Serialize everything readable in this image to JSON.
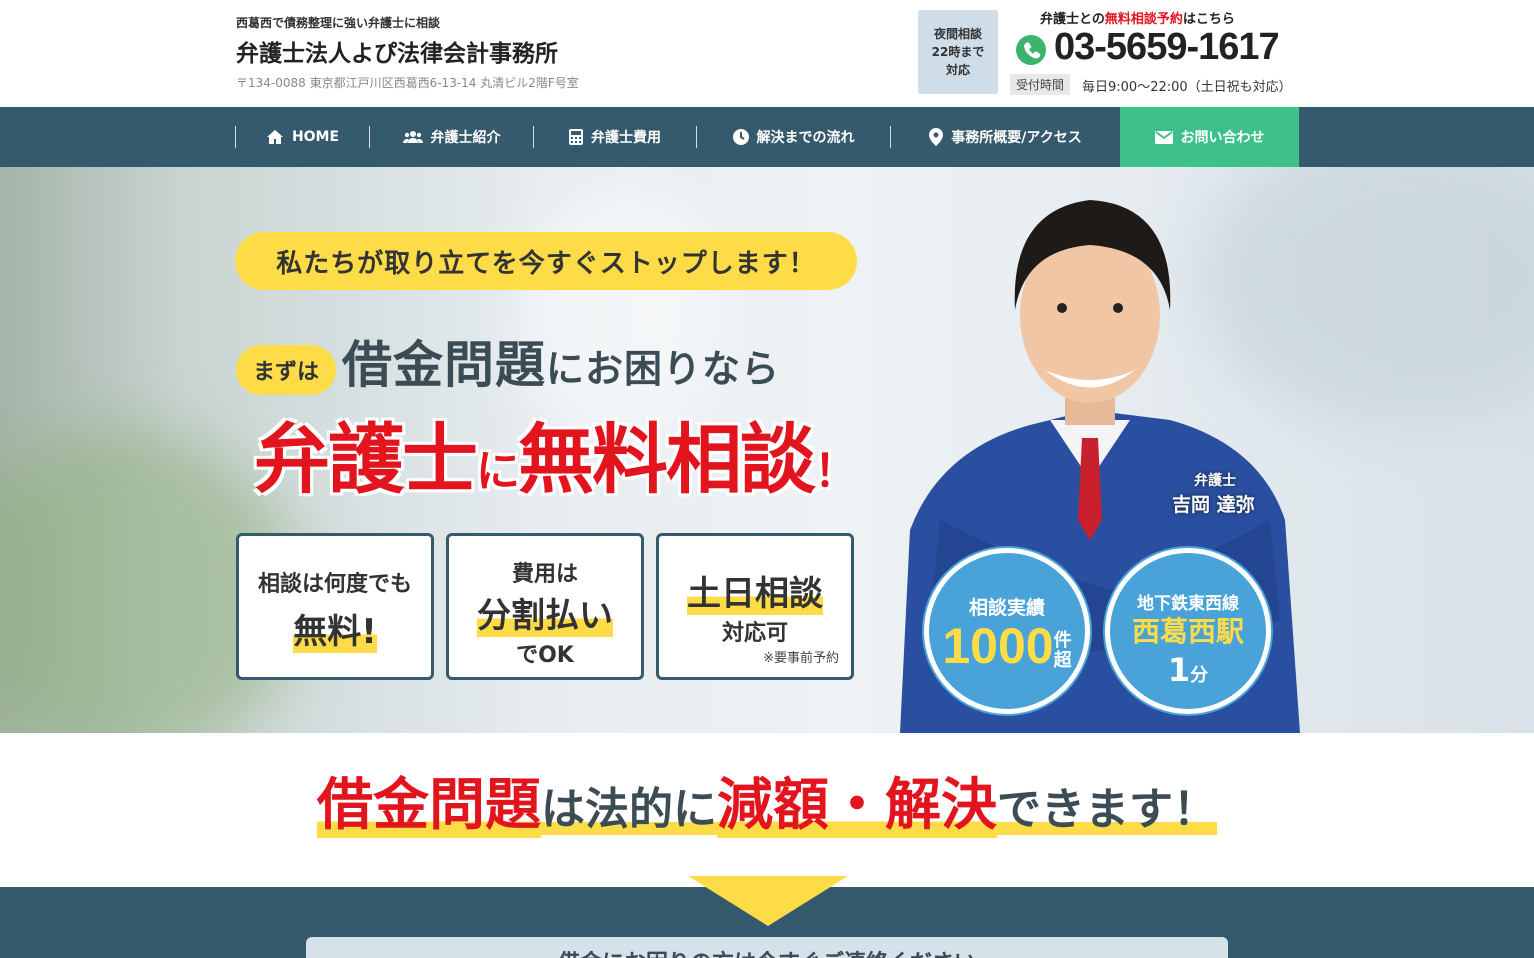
{
  "header": {
    "tagline": "西葛西で債務整理に強い弁護士に相談",
    "firm_name": "弁護士法人よぴ法律会計事務所",
    "address": "〒134-0088 東京都江戸川区西葛西6-13-14 丸清ビル2階F号室",
    "night_consult": [
      "夜間相談",
      "22時まで",
      "対応"
    ],
    "cta_pre": "弁護士との",
    "cta_red": "無料相談予約",
    "cta_post": "はこちら",
    "phone": "03-5659-1617",
    "hours_label": "受付時間",
    "hours": "毎日9:00〜22:00（土日祝も対応）"
  },
  "nav": {
    "items": [
      {
        "label": "HOME",
        "icon": "home-icon"
      },
      {
        "label": "弁護士紹介",
        "icon": "users-icon"
      },
      {
        "label": "弁護士費用",
        "icon": "calculator-icon"
      },
      {
        "label": "解決までの流れ",
        "icon": "clock-icon"
      },
      {
        "label": "事務所概要/アクセス",
        "icon": "map-pin-icon"
      },
      {
        "label": "お問い合わせ",
        "icon": "mail-icon"
      }
    ]
  },
  "hero": {
    "pill": "私たちが取り立てを今すぐストップします！",
    "mazu": "まずは",
    "head1_big": "借金問題",
    "head1_small": "にお困りなら",
    "head2_a": "弁護士",
    "head2_b": "に",
    "head2_c": "無料相談",
    "head2_d": "！",
    "cards": [
      {
        "t1": "相談は何度でも",
        "t2": "無料!"
      },
      {
        "t1": "費用は",
        "t2": "分割払い",
        "t3": "でOK"
      },
      {
        "t2": "土日相談",
        "t3": "対応可",
        "t4": "※要事前予約"
      }
    ],
    "lawyer_role": "弁護士",
    "lawyer_name": "吉岡 達弥",
    "badge1": {
      "top": "相談実績",
      "num": "1000",
      "unit1": "件",
      "unit2": "超"
    },
    "badge2": {
      "top": "地下鉄東西線",
      "mid": "西葛西駅",
      "num": "1",
      "unit": "分"
    }
  },
  "section": {
    "title_red1": "借金問題",
    "title_dark1": "は法的に",
    "title_red2": "減額・解決",
    "title_dark2": "できます！",
    "panel_text": "借金にお困りの方は今すぐご連絡ください"
  },
  "colors": {
    "nav": "#365a6d",
    "accent_green": "#3ec08a",
    "yellow": "#fddc47",
    "red": "#e2141e",
    "badge": "#4aa3d8"
  }
}
